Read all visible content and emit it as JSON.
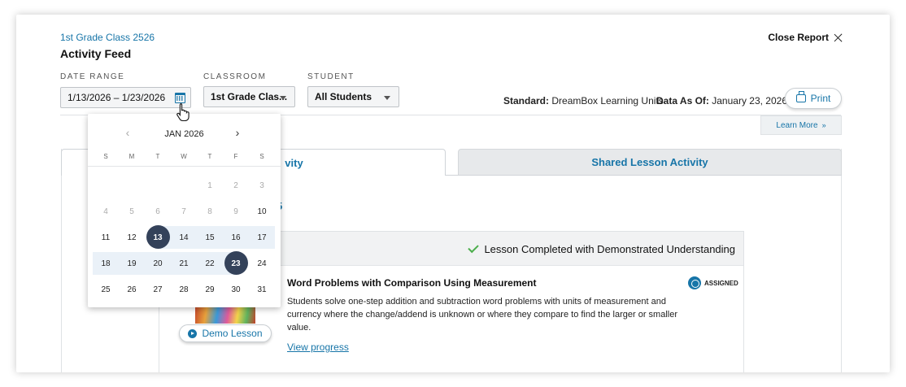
{
  "header": {
    "class_link": "1st Grade Class 2526",
    "title": "Activity Feed",
    "close_label": "Close Report"
  },
  "filters": {
    "date_range_label": "DATE RANGE",
    "date_range_value": "1/13/2026 – 1/23/2026",
    "classroom_label": "CLASSROOM",
    "classroom_value": "1st Grade Clas...",
    "student_label": "STUDENT",
    "student_value": "All Students"
  },
  "meta": {
    "standard_label": "Standard:",
    "standard_value": "DreamBox Learning Units",
    "data_as_of_label": "Data As Of:",
    "data_as_of_value": "January 23, 2026",
    "print_label": "Print",
    "learn_more_label": "Learn More"
  },
  "tabs": [
    {
      "label": "vity",
      "active": true
    },
    {
      "label": "Shared Lesson Activity",
      "active": false
    }
  ],
  "partial_text": "5",
  "lesson": {
    "status": "Lesson Completed with Demonstrated Understanding",
    "title": "Word Problems with Comparison Using Measurement",
    "description": "Students solve one-step addition and subtraction word problems with units of measurement and currency where the change/addend is unknown or where they compare to find the larger or smaller value.",
    "view_progress": "View progress",
    "badge": "ASSIGNED",
    "demo_label": "Demo Lesson"
  },
  "calendar": {
    "month": "JAN 2026",
    "weekdays": [
      "S",
      "M",
      "T",
      "W",
      "T",
      "F",
      "S"
    ],
    "weeks": [
      [
        "",
        "",
        "",
        "",
        "1",
        "2",
        "3"
      ],
      [
        "4",
        "5",
        "6",
        "7",
        "8",
        "9",
        "10"
      ],
      [
        "11",
        "12",
        "13",
        "14",
        "15",
        "16",
        "17"
      ],
      [
        "18",
        "19",
        "20",
        "21",
        "22",
        "23",
        "24"
      ],
      [
        "25",
        "26",
        "27",
        "28",
        "29",
        "30",
        "31"
      ]
    ],
    "disabled_through": 9,
    "range_start": 13,
    "range_end": 23
  },
  "colors": {
    "accent": "#1775a8",
    "selected_day": "#34425a",
    "range_band": "#eaf1f8",
    "check": "#4cae4c"
  }
}
